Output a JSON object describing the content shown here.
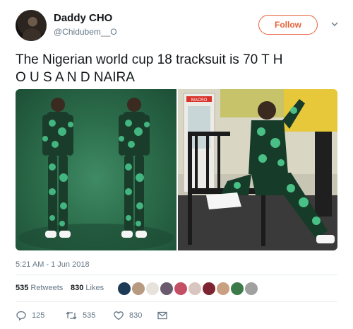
{
  "user": {
    "display_name": "Daddy CHO",
    "handle": "@Chidubem__O",
    "follow_label": "Follow"
  },
  "tweet": {
    "text": "The Nigerian world cup 18 tracksuit is 70 T H\nO U S A N D NAIRA",
    "timestamp": "5:21 AM - 1 Jun 2018"
  },
  "media": {
    "photos": [
      {
        "icon": "photo-two-men-green-tracksuit"
      },
      {
        "icon": "photo-man-seated-green-tracksuit",
        "sign_text": "MACRO"
      }
    ]
  },
  "stats": {
    "retweets_count": "535",
    "retweets_label": "Retweets",
    "likes_count": "830",
    "likes_label": "Likes",
    "liker_avatars": 10
  },
  "actions": {
    "reply_count": "125",
    "retweet_count": "535",
    "like_count": "830"
  },
  "colors": {
    "accent": "#e8623a",
    "text_primary": "#14171a",
    "text_secondary": "#657786",
    "divider": "#e6ecf0",
    "tracksuit_green": "#2c6e4c"
  }
}
